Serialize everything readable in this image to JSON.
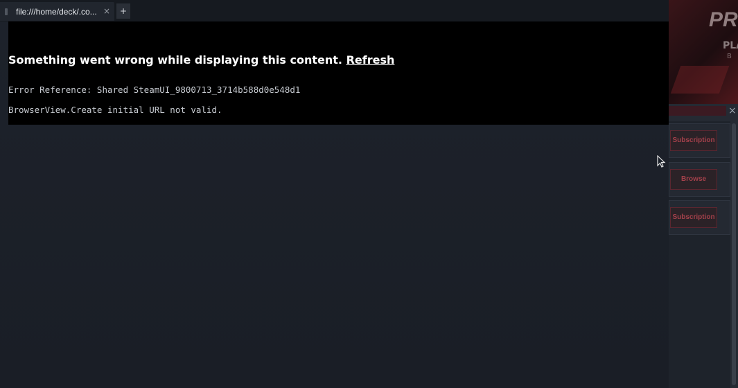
{
  "tab": {
    "title": "file:///home/deck/.co...",
    "close_glyph": "×",
    "new_tab_glyph": "+"
  },
  "error": {
    "message": "Something went wrong while displaying this content.",
    "refresh_label": "Refresh",
    "reference": "Error Reference: Shared SteamUI_9800713_3714b588d0e548d1",
    "detail": "BrowserView.Create initial URL not valid."
  },
  "side_panel": {
    "banner_big": "PRE",
    "banner_line1": "PLA",
    "banner_line2": "B",
    "close_glyph": "×",
    "buttons": [
      "Subscription",
      "Browse",
      "Subscription"
    ]
  },
  "colors": {
    "accent": "#a4414b",
    "background": "#1b2029",
    "error_panel": "#000000"
  },
  "icons": [
    "tab-favicon-icon",
    "close-icon",
    "plus-icon",
    "mouse-cursor-icon"
  ]
}
